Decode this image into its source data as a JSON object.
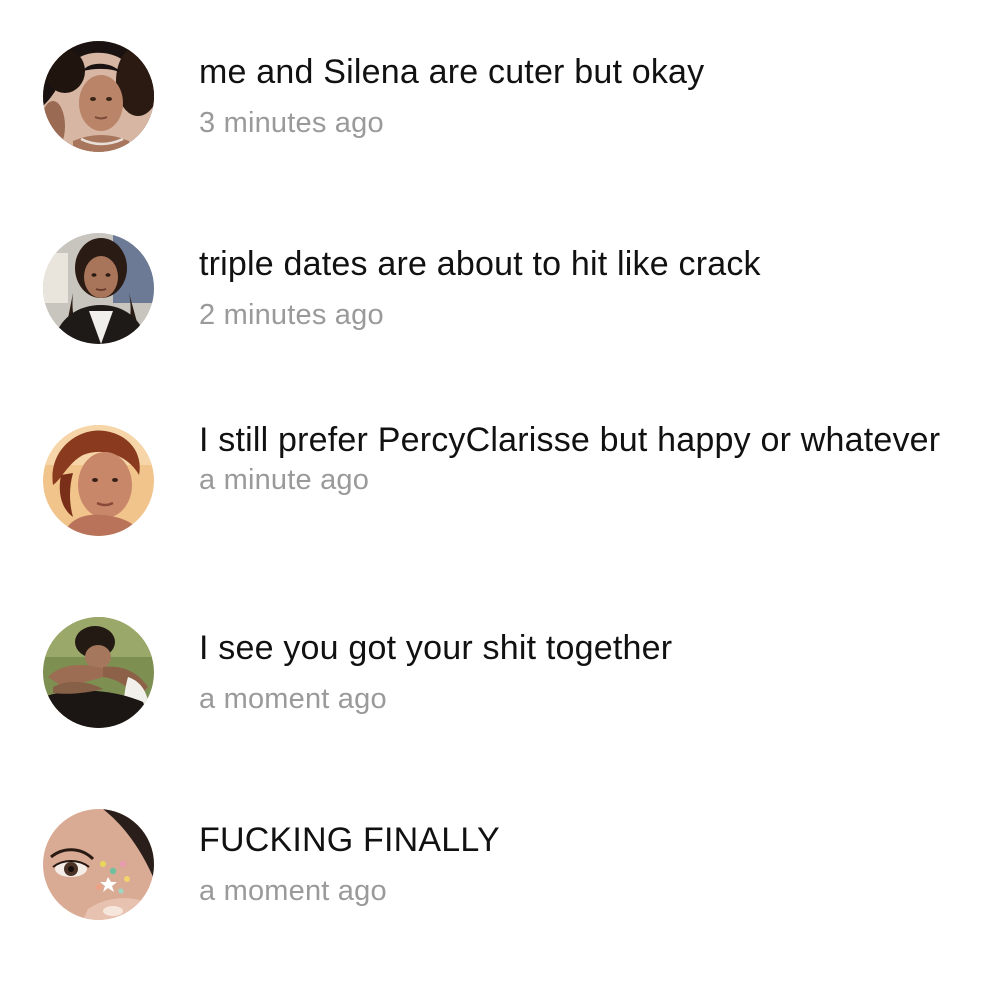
{
  "comments": [
    {
      "avatar_icon": "profile-photo-curly-hair",
      "text": "me and Silena are cuter but okay",
      "time": "3 minutes ago"
    },
    {
      "avatar_icon": "profile-photo-jacket",
      "text": "triple dates are about to hit like crack",
      "time": "2 minutes ago"
    },
    {
      "avatar_icon": "profile-photo-red-hair",
      "text": "I still prefer PercyClarisse but happy or whatever",
      "time": "a minute ago"
    },
    {
      "avatar_icon": "profile-photo-outdoor",
      "text": "I see you got your shit together",
      "time": "a moment ago"
    },
    {
      "avatar_icon": "profile-photo-eye-closeup",
      "text": "FUCKING FINALLY",
      "time": "a moment ago"
    }
  ],
  "colors": {
    "text": "#111111",
    "timestamp": "#9a9a9a",
    "background": "#ffffff"
  }
}
